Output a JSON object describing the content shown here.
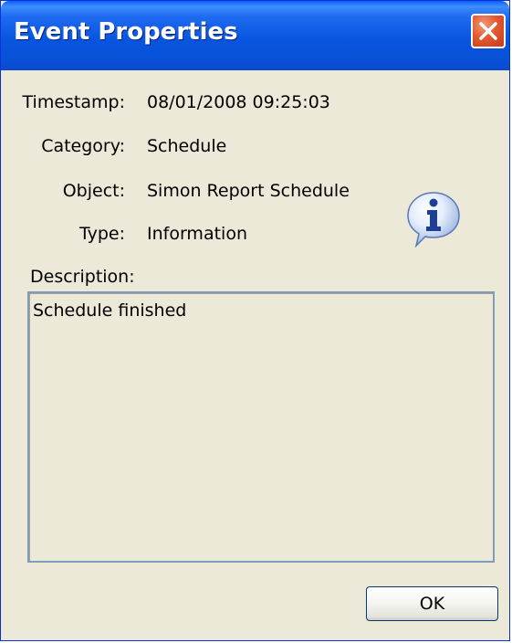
{
  "window": {
    "title": "Event Properties"
  },
  "fields": {
    "timestamp_label": "Timestamp:",
    "timestamp_value": "08/01/2008 09:25:03",
    "category_label": "Category:",
    "category_value": "Schedule",
    "object_label": "Object:",
    "object_value": "Simon Report Schedule",
    "type_label": "Type:",
    "type_value": "Information"
  },
  "description": {
    "label": "Description:",
    "text": "Schedule finished"
  },
  "buttons": {
    "ok_label": "OK"
  },
  "icons": {
    "close": "close-icon",
    "info": "information-icon"
  },
  "colors": {
    "titlebar": "#0855e0",
    "window_bg": "#ece9d8",
    "close_button": "#e3592f"
  }
}
